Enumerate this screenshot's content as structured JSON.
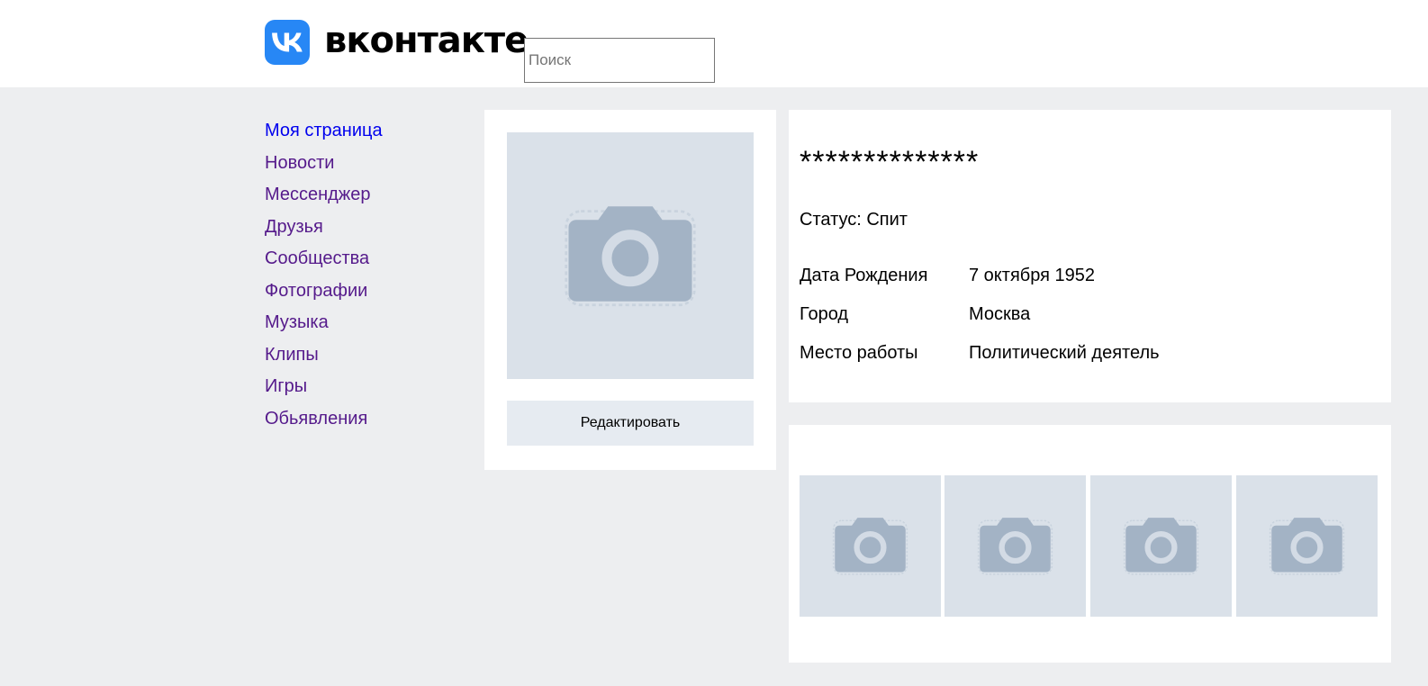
{
  "header": {
    "logo_text": "вконтакте",
    "search_placeholder": "Поиск"
  },
  "sidebar": {
    "items": [
      {
        "label": "Моя страница"
      },
      {
        "label": "Новости"
      },
      {
        "label": "Мессенджер"
      },
      {
        "label": "Друзья"
      },
      {
        "label": "Сообщества"
      },
      {
        "label": "Фотографии"
      },
      {
        "label": "Музыка"
      },
      {
        "label": "Клипы"
      },
      {
        "label": "Игры"
      },
      {
        "label": "Обьявления"
      }
    ]
  },
  "profile": {
    "avatar_icon": "camera-icon",
    "edit_label": "Редактировать",
    "name": "**************",
    "status": "Статус: Спит",
    "fields": [
      {
        "key": "Дата Рождения",
        "value": "7 октября 1952"
      },
      {
        "key": "Город",
        "value": "Москва"
      },
      {
        "key": "Место работы",
        "value": "Политический деятель"
      }
    ]
  },
  "photos": {
    "thumbnail_icon": "camera-icon",
    "count_shown": 4
  },
  "colors": {
    "brand": "#2787f5",
    "page_bg": "#edeef0",
    "placeholder_bg": "#dae1e9",
    "camera": "#a3b3c5",
    "link": "#551a8b",
    "link_active": "#0000ee"
  }
}
